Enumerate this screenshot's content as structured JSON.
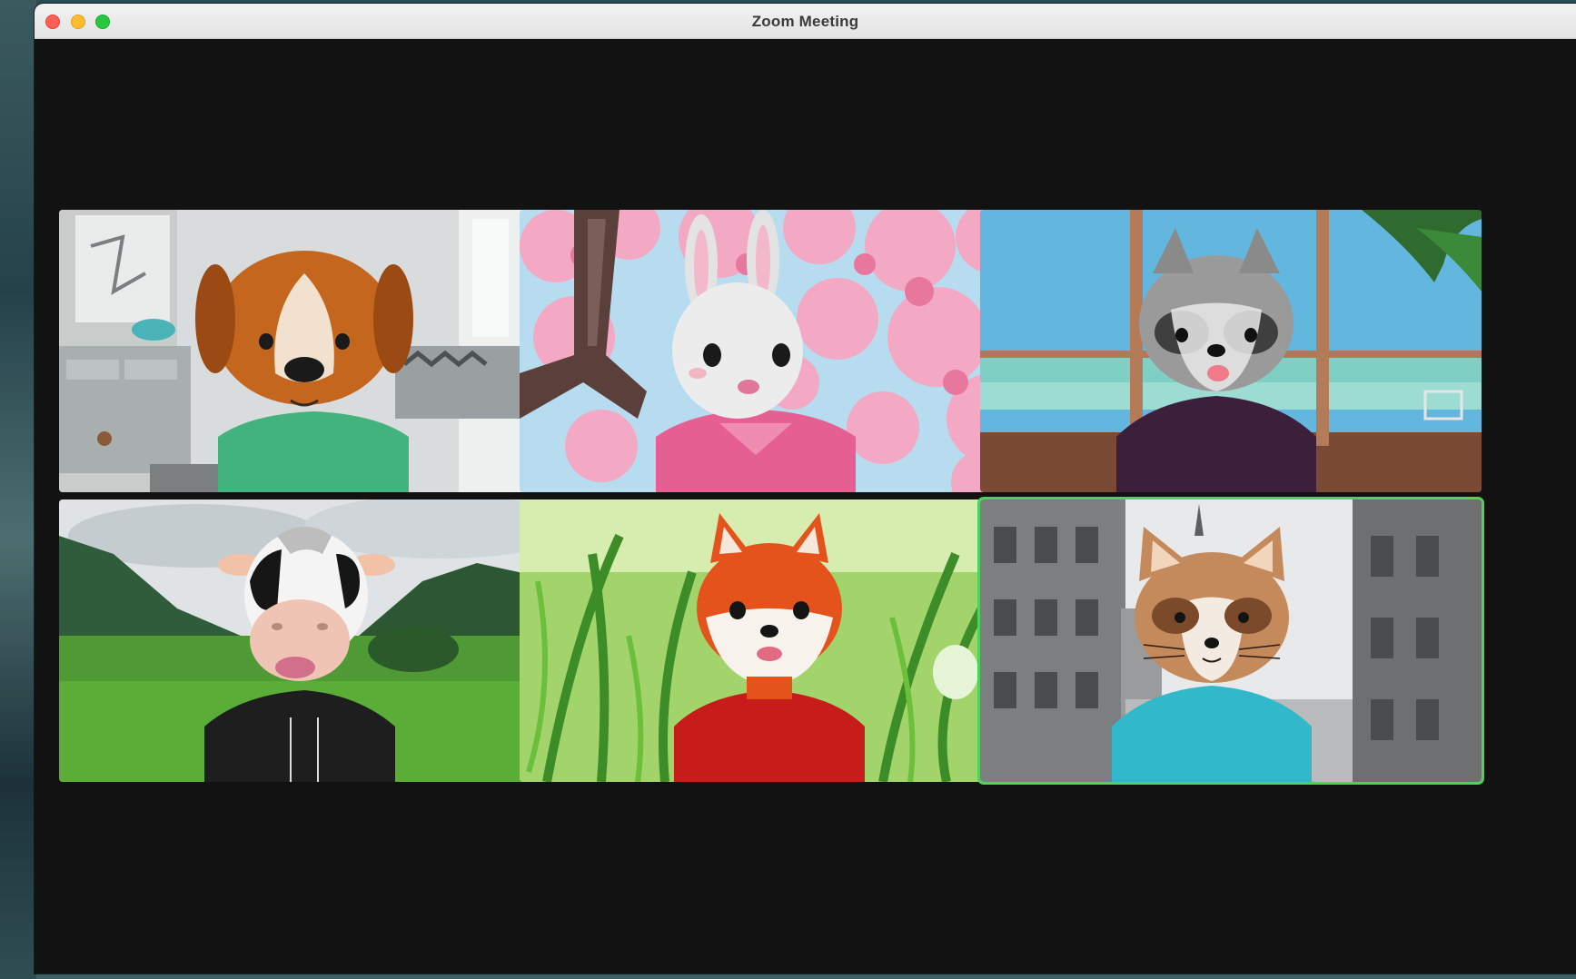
{
  "window": {
    "title": "Zoom Meeting"
  },
  "participants": [
    {
      "avatar": "dog-avatar",
      "background": "living-room",
      "active_speaker": false
    },
    {
      "avatar": "bunny-avatar",
      "background": "cherry-blossoms",
      "active_speaker": false
    },
    {
      "avatar": "raccoon-avatar",
      "background": "beach-window",
      "active_speaker": false
    },
    {
      "avatar": "cow-avatar",
      "background": "green-valley",
      "active_speaker": false
    },
    {
      "avatar": "fox-avatar",
      "background": "tall-grass",
      "active_speaker": false
    },
    {
      "avatar": "cat-avatar",
      "background": "paris-street",
      "active_speaker": true
    }
  ],
  "colors": {
    "active_speaker_border": "#4cd35a",
    "meeting_background": "#121212"
  }
}
